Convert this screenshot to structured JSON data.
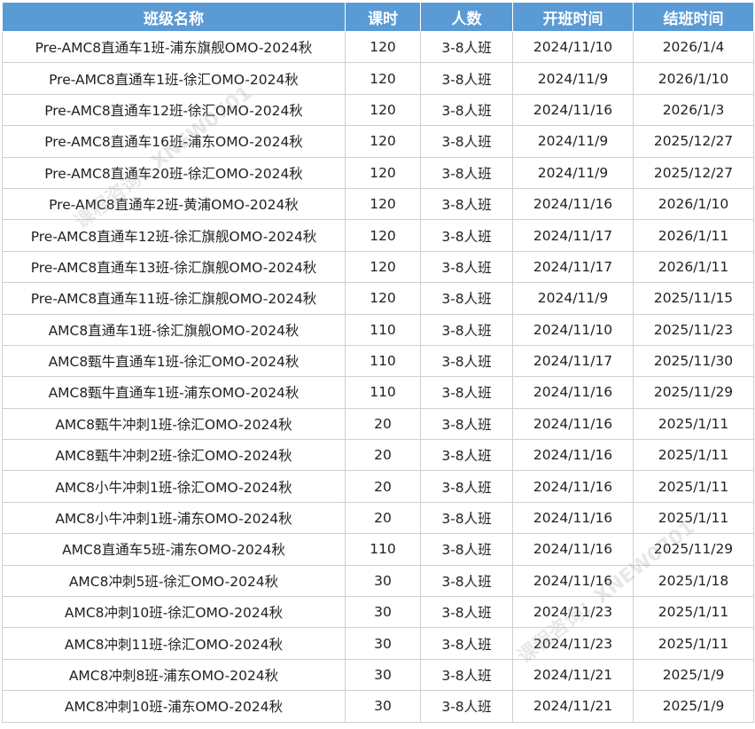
{
  "table": {
    "headers": [
      "班级名称",
      "课时",
      "人数",
      "开班时间",
      "结班时间"
    ],
    "rows": [
      [
        "Pre-AMC8直通车1班-浦东旗舰OMO-2024秋",
        "120",
        "3-8人班",
        "2024/11/10",
        "2026/1/4"
      ],
      [
        "Pre-AMC8直通车1班-徐汇OMO-2024秋",
        "120",
        "3-8人班",
        "2024/11/9",
        "2026/1/10"
      ],
      [
        "Pre-AMC8直通车12班-徐汇OMO-2024秋",
        "120",
        "3-8人班",
        "2024/11/16",
        "2026/1/3"
      ],
      [
        "Pre-AMC8直通车16班-浦东OMO-2024秋",
        "120",
        "3-8人班",
        "2024/11/9",
        "2025/12/27"
      ],
      [
        "Pre-AMC8直通车20班-徐汇OMO-2024秋",
        "120",
        "3-8人班",
        "2024/11/9",
        "2025/12/27"
      ],
      [
        "Pre-AMC8直通车2班-黄浦OMO-2024秋",
        "120",
        "3-8人班",
        "2024/11/16",
        "2026/1/10"
      ],
      [
        "Pre-AMC8直通车12班-徐汇旗舰OMO-2024秋",
        "120",
        "3-8人班",
        "2024/11/17",
        "2026/1/11"
      ],
      [
        "Pre-AMC8直通车13班-徐汇旗舰OMO-2024秋",
        "120",
        "3-8人班",
        "2024/11/17",
        "2026/1/11"
      ],
      [
        "Pre-AMC8直通车11班-徐汇旗舰OMO-2024秋",
        "120",
        "3-8人班",
        "2024/11/9",
        "2025/11/15"
      ],
      [
        "AMC8直通车1班-徐汇旗舰OMO-2024秋",
        "110",
        "3-8人班",
        "2024/11/10",
        "2025/11/23"
      ],
      [
        "AMC8甄牛直通车1班-徐汇OMO-2024秋",
        "110",
        "3-8人班",
        "2024/11/17",
        "2025/11/30"
      ],
      [
        "AMC8甄牛直通车1班-浦东OMO-2024秋",
        "110",
        "3-8人班",
        "2024/11/16",
        "2025/11/29"
      ],
      [
        "AMC8甄牛冲刺1班-徐汇OMO-2024秋",
        "20",
        "3-8人班",
        "2024/11/16",
        "2025/1/11"
      ],
      [
        "AMC8甄牛冲刺2班-徐汇OMO-2024秋",
        "20",
        "3-8人班",
        "2024/11/16",
        "2025/1/11"
      ],
      [
        "AMC8小牛冲刺1班-徐汇OMO-2024秋",
        "20",
        "3-8人班",
        "2024/11/16",
        "2025/1/11"
      ],
      [
        "AMC8小牛冲刺1班-浦东OMO-2024秋",
        "20",
        "3-8人班",
        "2024/11/16",
        "2025/1/11"
      ],
      [
        "AMC8直通车5班-浦东OMO-2024秋",
        "110",
        "3-8人班",
        "2024/11/16",
        "2025/11/29"
      ],
      [
        "AMC8冲刺5班-徐汇OMO-2024秋",
        "30",
        "3-8人班",
        "2024/11/16",
        "2025/1/18"
      ],
      [
        "AMC8冲刺10班-徐汇OMO-2024秋",
        "30",
        "3-8人班",
        "2024/11/23",
        "2025/1/11"
      ],
      [
        "AMC8冲刺11班-徐汇OMO-2024秋",
        "30",
        "3-8人班",
        "2024/11/23",
        "2025/1/11"
      ],
      [
        "AMC8冲刺8班-浦东OMO-2024秋",
        "30",
        "3-8人班",
        "2024/11/21",
        "2025/1/9"
      ],
      [
        "AMC8冲刺10班-浦东OMO-2024秋",
        "30",
        "3-8人班",
        "2024/11/21",
        "2025/1/9"
      ]
    ]
  },
  "watermark": {
    "text": "课程咨询：XNEW0701"
  },
  "colors": {
    "header_bg": "#5b9bd5",
    "header_text": "#ffffff",
    "grid": "#cfcfcf"
  }
}
